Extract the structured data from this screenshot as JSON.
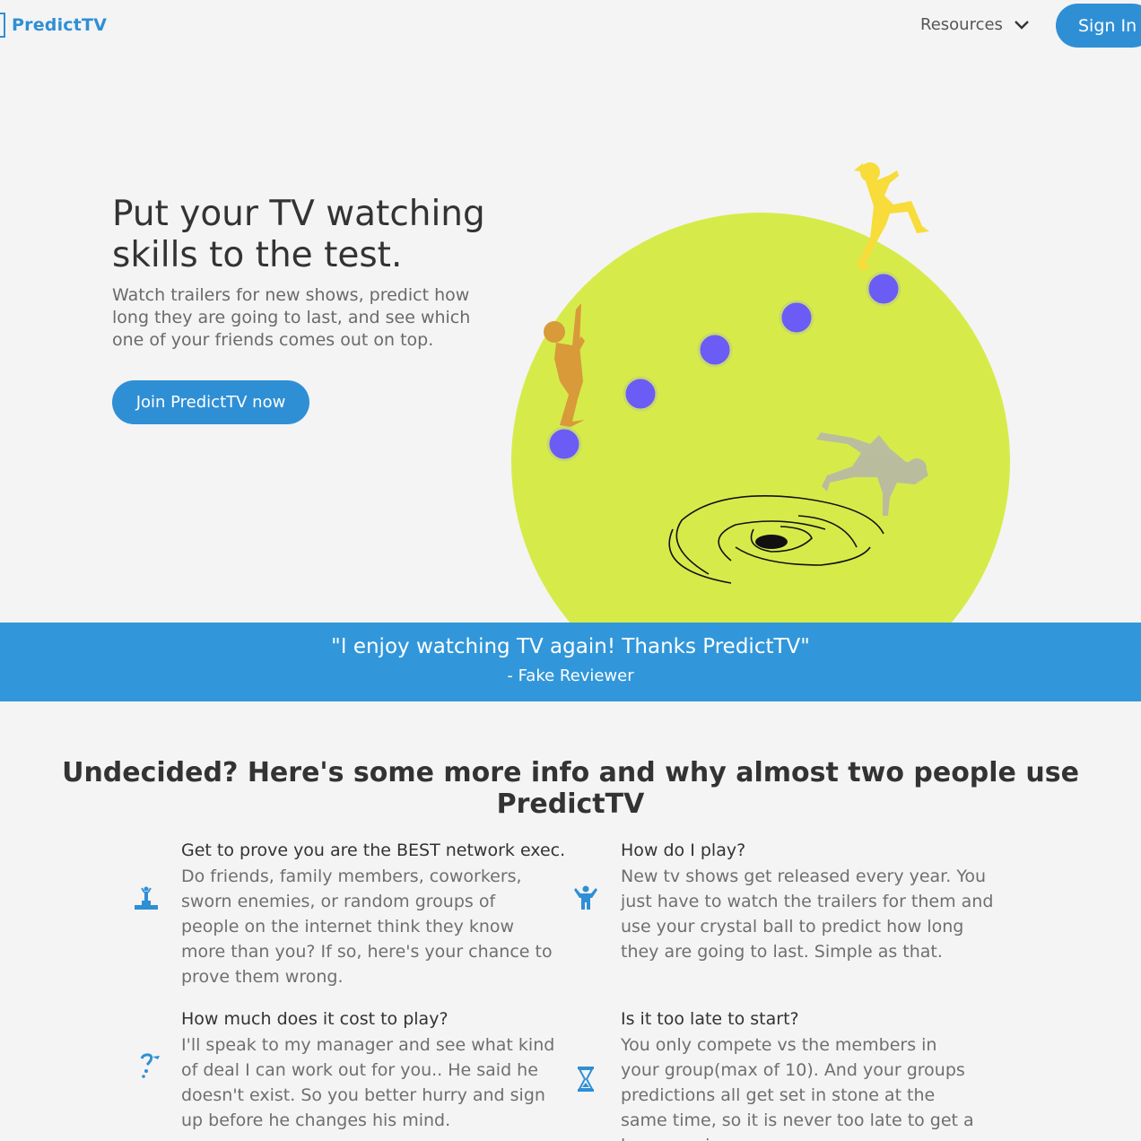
{
  "brand": {
    "name": "PredictTV",
    "color": "#2f8fd5"
  },
  "nav": {
    "resources_label": "Resources",
    "signin_label": "Sign In"
  },
  "hero": {
    "title": "Put your TV watching skills to the test.",
    "subtitle": "Watch trailers for new shows, predict how long they are going to last, and see which one of your friends comes out on top.",
    "cta_label": "Join PredictTV now"
  },
  "banner": {
    "quote": "\"I enjoy watching TV again! Thanks PredictTV\"",
    "author": "- Fake Reviewer",
    "bg_color": "#3197da"
  },
  "info": {
    "heading": "Undecided? Here's some more info and why almost two people use PredictTV",
    "features": [
      {
        "icon": "podium-icon",
        "title": "Get to prove you are the BEST network exec.",
        "body": "Do friends, family members, coworkers, sworn enemies, or random groups of people on the internet think they know more than you? If so, here's your chance to prove them wrong."
      },
      {
        "icon": "person-icon",
        "title": "How do I play?",
        "body": "New tv shows get released every year. You just have to watch the trailers for them and use your crystal ball to predict how long they are going to last. Simple as that."
      },
      {
        "icon": "question-person-icon",
        "title": "How much does it cost to play?",
        "body": "I'll speak to my manager and see what kind of deal I can work out for you.. He said he doesn't exist. So you better hurry and sign up before he changes his mind."
      },
      {
        "icon": "hourglass-icon",
        "title": "Is it too late to start?",
        "body": "You only compete vs the members in your group(max of 10). And your groups predictions all get set in stone at the same time, so it is never too late to get a league going."
      }
    ]
  },
  "colors": {
    "circle": "#d6eb4a",
    "dot": "#6b5cf6",
    "figure_orange": "#d99a3a",
    "figure_yellow": "#f7dc3a",
    "figure_gray": "#b8b8a8"
  }
}
